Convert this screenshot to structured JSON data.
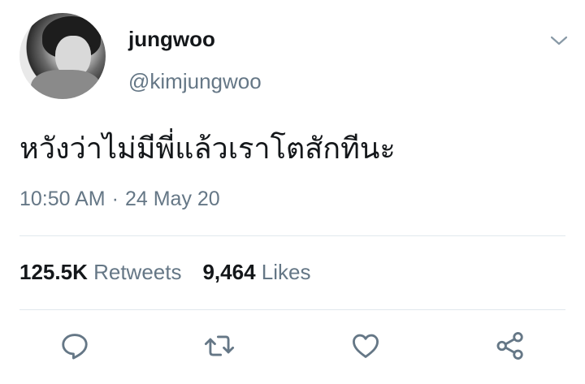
{
  "user": {
    "display_name": "jungwoo",
    "handle": "@kimjungwoo"
  },
  "tweet": {
    "text": "หวังว่าไม่มีพี่แล้วเราโตสักทีนะ",
    "time": "10:50 AM",
    "separator": "·",
    "date": "24 May 20"
  },
  "stats": {
    "retweets_count": "125.5K",
    "retweets_label": "Retweets",
    "likes_count": "9,464",
    "likes_label": "Likes"
  },
  "icons": {
    "menu": "chevron-down-icon",
    "reply": "reply-icon",
    "retweet": "retweet-icon",
    "like": "heart-icon",
    "share": "share-icon"
  },
  "colors": {
    "primary_text": "#14171a",
    "secondary_text": "#657786",
    "icon": "#657786",
    "divider": "#e1e8ed"
  }
}
